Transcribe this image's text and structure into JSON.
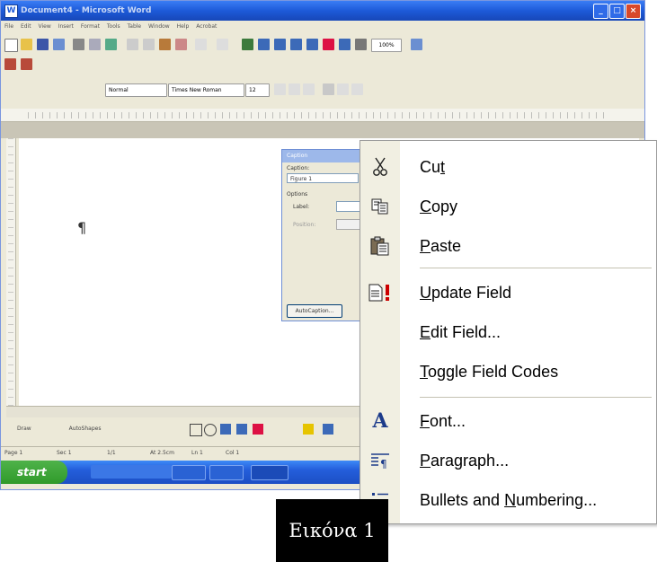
{
  "window": {
    "title": "Document4 - Microsoft Word",
    "menus": [
      "File",
      "Edit",
      "View",
      "Insert",
      "Format",
      "Tools",
      "Table",
      "Window",
      "Help",
      "Acrobat"
    ],
    "style_box": "Normal",
    "font_box": "Times New Roman",
    "size_box": "12",
    "zoom": "100%",
    "draw_label": "Draw",
    "autoshapes_label": "AutoShapes",
    "status": {
      "page": "Page 1",
      "sec": "Sec 1",
      "pos": "1/1",
      "at": "At 2.5cm",
      "ln": "Ln 1",
      "col": "Col 1"
    },
    "start_label": "start"
  },
  "dialog": {
    "title": "Caption",
    "caption_label": "Caption:",
    "caption_value": "Figure 1",
    "options_label": "Options",
    "label_label": "Label:",
    "position_label": "Position:",
    "autocaption_label": "AutoCaption..."
  },
  "context_menu": {
    "items": [
      {
        "icon": "scissors-icon",
        "pre": "Cu",
        "acc": "t",
        "post": ""
      },
      {
        "icon": "copy-icon",
        "pre": "",
        "acc": "C",
        "post": "opy"
      },
      {
        "icon": "paste-icon",
        "pre": "",
        "acc": "P",
        "post": "aste"
      },
      {
        "icon": "update-field-icon",
        "pre": "",
        "acc": "U",
        "post": "pdate Field"
      },
      {
        "icon": "",
        "pre": "",
        "acc": "E",
        "post": "dit Field..."
      },
      {
        "icon": "",
        "pre": "",
        "acc": "T",
        "post": "oggle Field Codes"
      },
      {
        "icon": "font-icon",
        "pre": "",
        "acc": "F",
        "post": "ont..."
      },
      {
        "icon": "paragraph-icon",
        "pre": "",
        "acc": "P",
        "post": "aragraph..."
      },
      {
        "icon": "bullets-icon",
        "pre": "Bullets and ",
        "acc": "N",
        "post": "umbering..."
      }
    ]
  },
  "caption_text": "Εικόνα 1",
  "colors": {
    "title_blue": "#1d5ad8",
    "menu_gutter": "#f1efe2",
    "start_green": "#2f9a2a"
  }
}
